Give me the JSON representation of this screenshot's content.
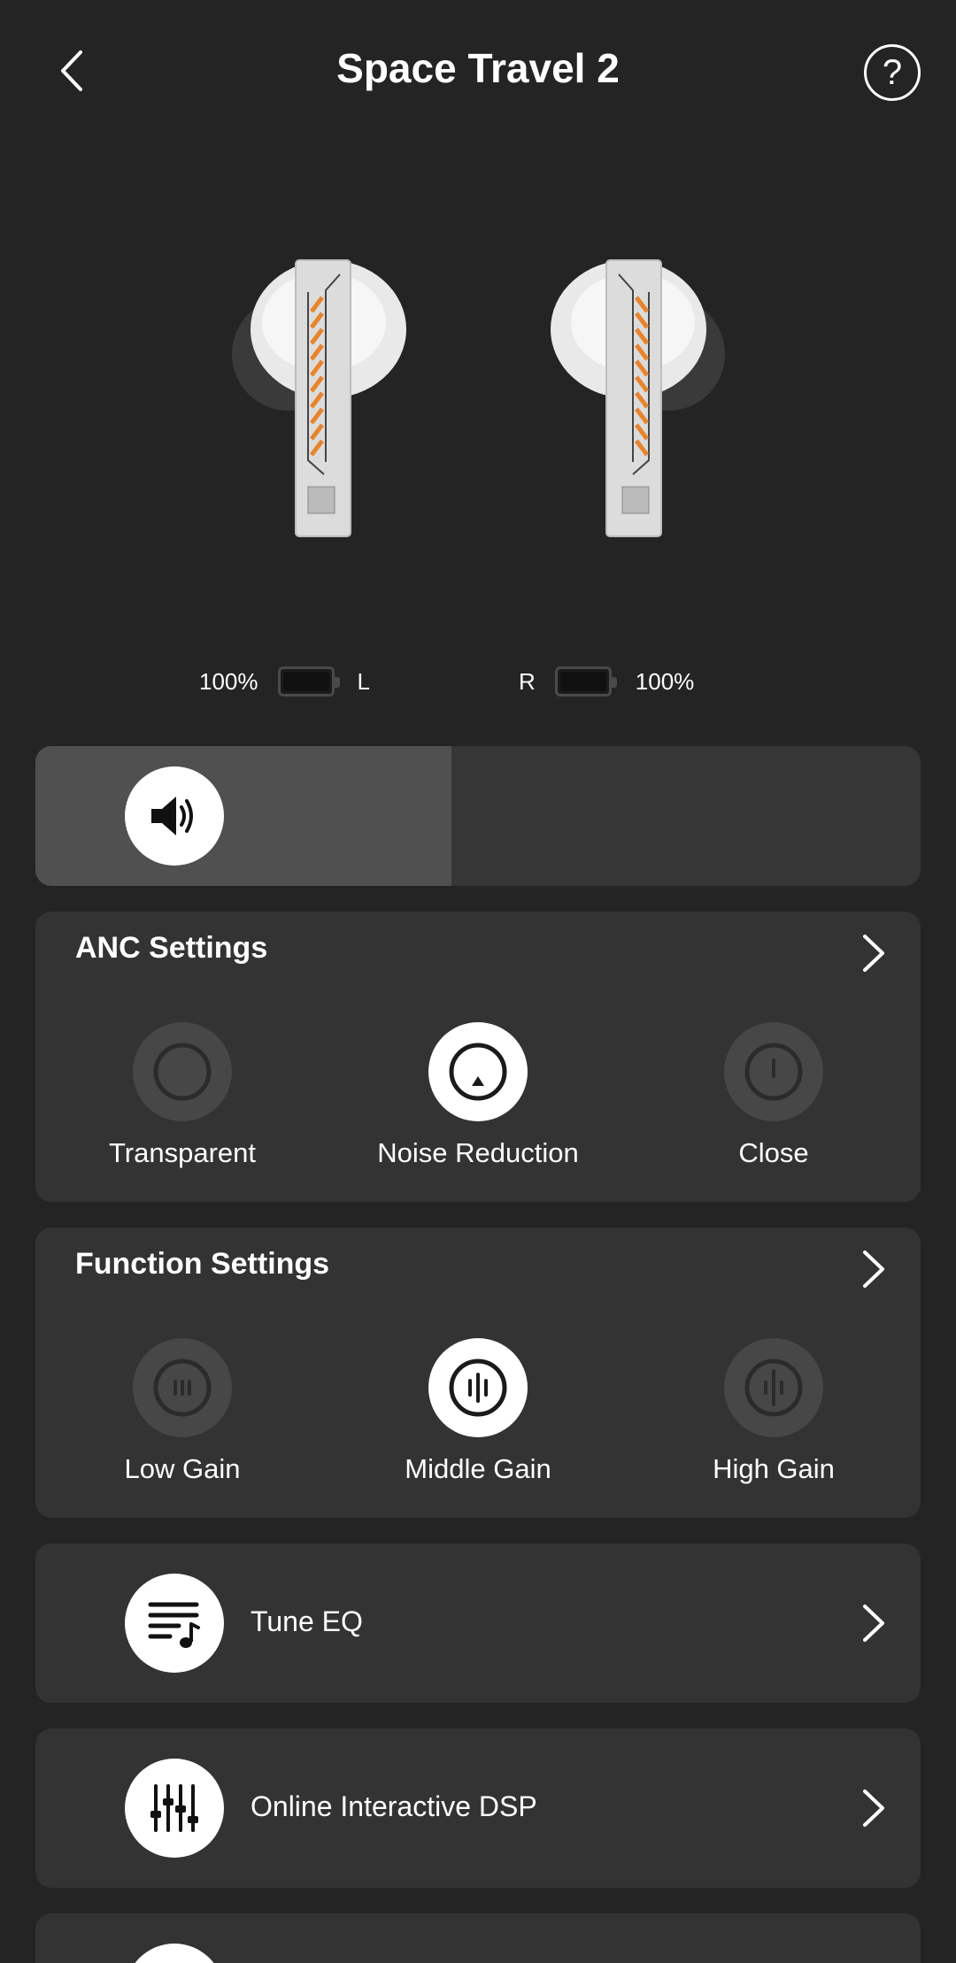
{
  "header": {
    "title": "Space Travel 2"
  },
  "icons": {
    "back": "chevron-left-icon",
    "help": "question-icon",
    "volume": "speaker-icon",
    "eq": "music-list-icon",
    "dsp": "sliders-icon",
    "chevron": "chevron-right-icon"
  },
  "battery": {
    "left": {
      "percent": "100%",
      "side": "L",
      "level": 1.0
    },
    "right": {
      "percent": "100%",
      "side": "R",
      "level": 1.0
    }
  },
  "volume": {
    "level": 0.47
  },
  "anc": {
    "title": "ANC Settings",
    "options": [
      {
        "label": "Transparent",
        "selected": false
      },
      {
        "label": "Noise Reduction",
        "selected": true
      },
      {
        "label": "Close",
        "selected": false
      }
    ]
  },
  "function": {
    "title": "Function Settings",
    "options": [
      {
        "label": "Low Gain",
        "selected": false
      },
      {
        "label": "Middle Gain",
        "selected": true
      },
      {
        "label": "High Gain",
        "selected": false
      }
    ]
  },
  "rows": {
    "eq": "Tune EQ",
    "dsp": "Online Interactive DSP"
  },
  "colors": {
    "background": "#242424",
    "card": "#333333",
    "accent_orange": "#e8842b"
  }
}
